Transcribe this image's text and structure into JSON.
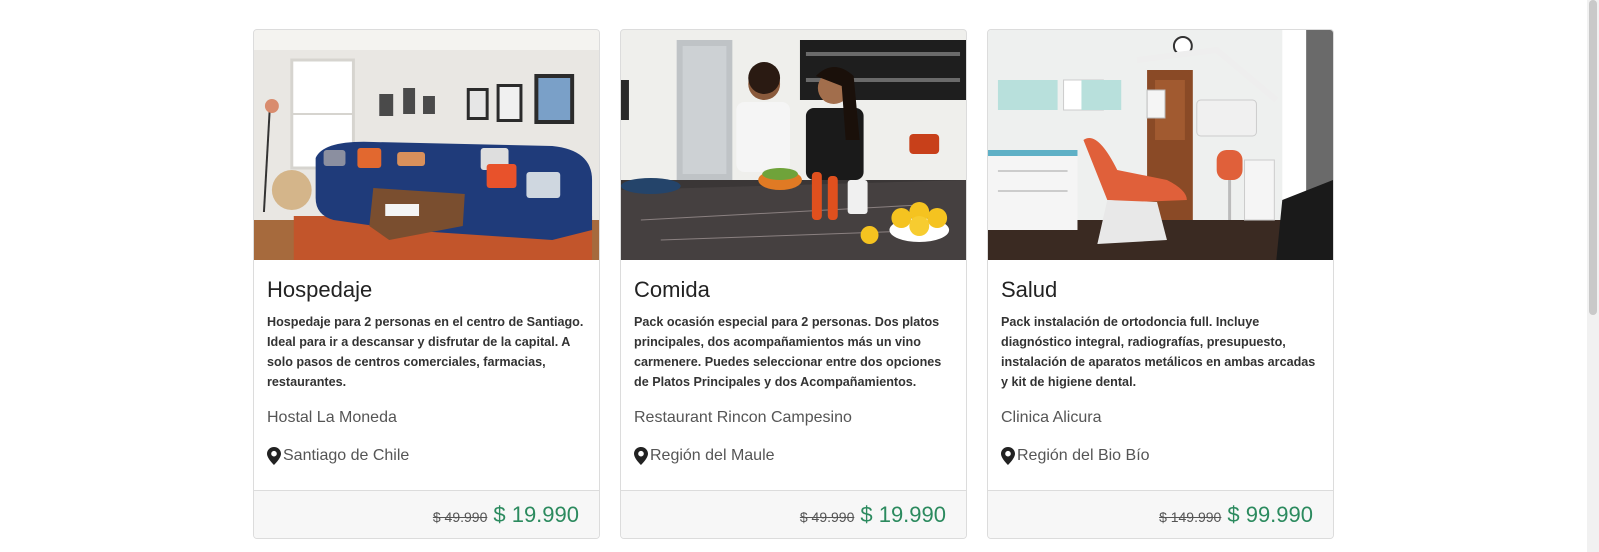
{
  "cards": [
    {
      "title": "Hospedaje",
      "description": "Hospedaje para 2 personas en el centro de Santiago. Ideal para ir a descansar y disfrutar de la capital. A solo pasos de centros comerciales, farmacias, restaurantes.",
      "merchant": "Hostal La Moneda",
      "location": "Santiago de Chile",
      "old_price": "$ 49.990",
      "new_price": "$ 19.990",
      "image_icon": "living-room-photo"
    },
    {
      "title": "Comida",
      "description": "Pack ocasión especial para 2 personas. Dos platos principales, dos acompañamientos más un vino carmenere. Puedes seleccionar entre dos opciones de Platos Principales y dos Acompañamientos.",
      "merchant": "Restaurant Rincon Campesino",
      "location": "Región del Maule",
      "old_price": "$ 49.990",
      "new_price": "$ 19.990",
      "image_icon": "kitchen-cooking-photo"
    },
    {
      "title": "Salud",
      "description": "Pack instalación de ortodoncia full. Incluye diagnóstico integral, radiografías, presupuesto, instalación de aparatos metálicos en ambas arcadas y kit de higiene dental.",
      "merchant": "Clinica Alicura",
      "location": "Región del Bio Bío",
      "old_price": "$ 149.990",
      "new_price": "$ 99.990",
      "image_icon": "dental-clinic-photo"
    }
  ],
  "colors": {
    "price_green": "#2b8a5e",
    "footer_bg": "#f7f7f7",
    "border": "#dcdcdc"
  }
}
